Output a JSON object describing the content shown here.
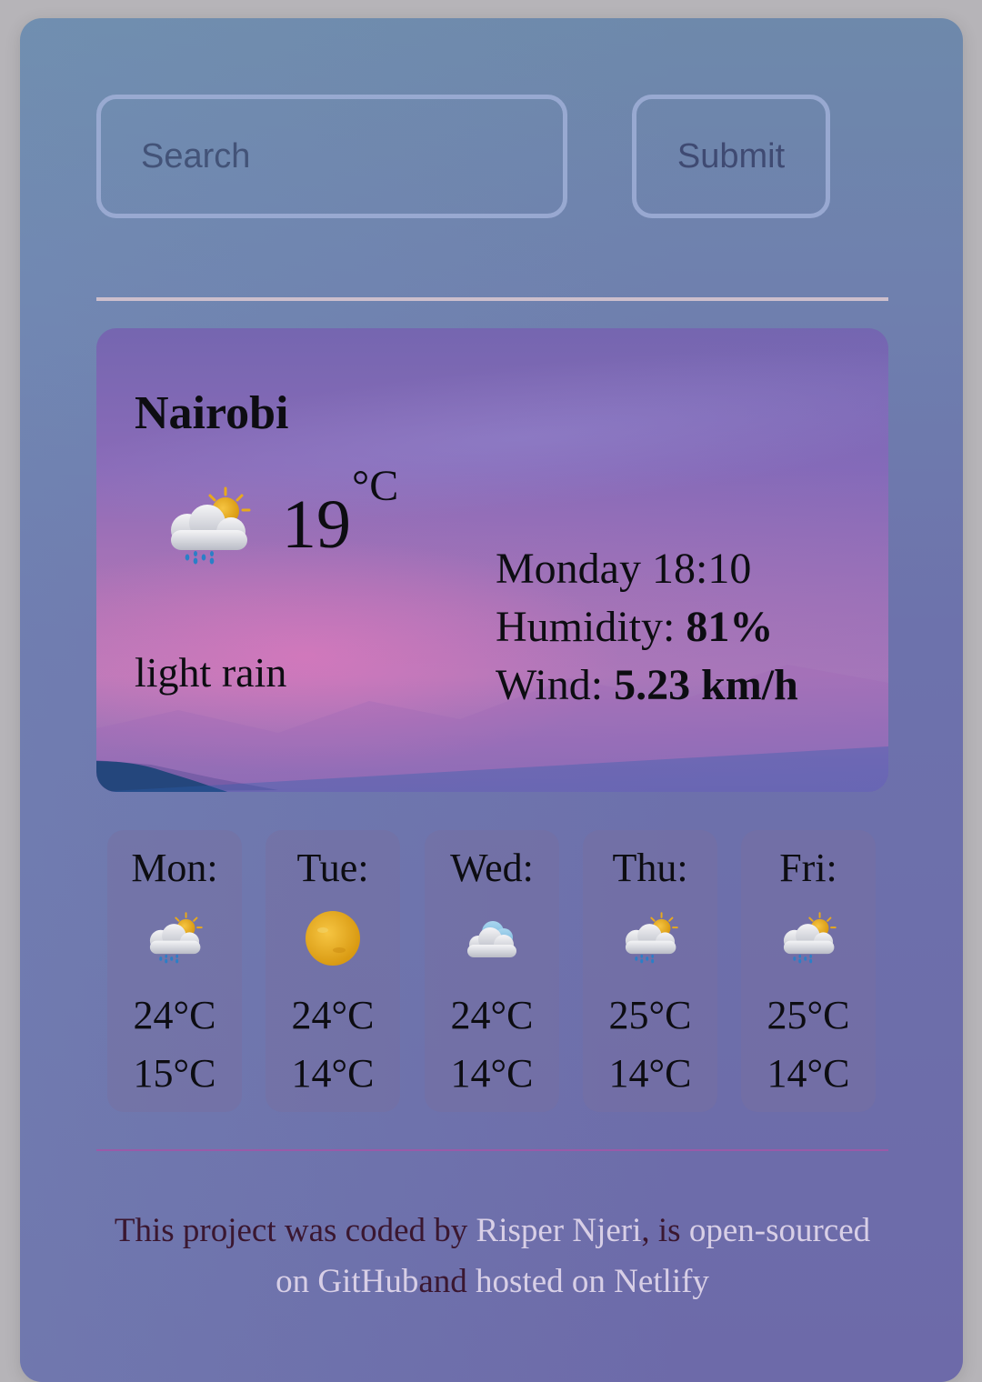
{
  "search": {
    "placeholder": "Search",
    "value": "",
    "submit_label": "Submit"
  },
  "current": {
    "city": "Nairobi",
    "icon": "rain-sun-cloud-icon",
    "temperature": "19",
    "unit": "°C",
    "description": "light rain",
    "datetime": "Monday 18:10",
    "humidity_label": "Humidity: ",
    "humidity_value": "81%",
    "wind_label": "Wind: ",
    "wind_value": "5.23 km/h"
  },
  "forecast": [
    {
      "day": "Mon:",
      "icon": "rain-sun-cloud-icon",
      "max": "24°C",
      "min": "15°C"
    },
    {
      "day": "Tue:",
      "icon": "sun-icon",
      "max": "24°C",
      "min": "14°C"
    },
    {
      "day": "Wed:",
      "icon": "cloud-icon",
      "max": "24°C",
      "min": "14°C"
    },
    {
      "day": "Thu:",
      "icon": "rain-sun-cloud-icon",
      "max": "25°C",
      "min": "14°C"
    },
    {
      "day": "Fri:",
      "icon": "rain-sun-cloud-icon",
      "max": "25°C",
      "min": "14°C"
    }
  ],
  "footer": {
    "text_1": "This project was coded by ",
    "author_link": "Risper Njeri",
    "text_2": ", is ",
    "github_link": "open-sourced on GitHub",
    "text_3": "and ",
    "netlify_link": "hosted on Netlify"
  },
  "colors": {
    "background": "#b6b4b8",
    "app_gradient_start": "#6e89ab",
    "app_gradient_end": "#6d6aa9",
    "text_dark": "#0d0d12",
    "footer_text": "#3a1730",
    "footer_link": "#d8cfe6",
    "divider_bottom": "#9a5aa8"
  }
}
